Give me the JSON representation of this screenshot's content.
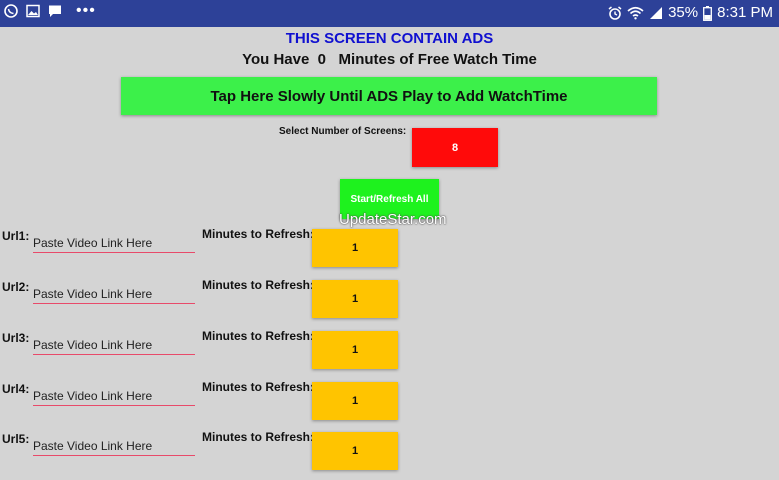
{
  "status_bar": {
    "battery": "35%",
    "time": "8:31 PM",
    "left_icons": [
      "viber-icon",
      "gallery-icon",
      "message-icon",
      "more-icon"
    ],
    "right_icons": [
      "alarm-icon",
      "wifi-icon",
      "signal-icon",
      "battery-icon"
    ]
  },
  "header": {
    "ads_notice": "THIS SCREEN CONTAIN ADS",
    "watch_prefix": "You Have",
    "watch_minutes": "0",
    "watch_suffix": "Minutes of Free Watch Time"
  },
  "ads_button_label": "Tap Here Slowly Until ADS Play to Add WatchTime",
  "screens": {
    "label": "Select Number of Screens:",
    "value": "8"
  },
  "start_button_label": "Start/Refresh All",
  "watermark": "UpdateStar.com",
  "rows": [
    {
      "url_label": "Url1:",
      "placeholder": "Paste Video Link Here",
      "minutes_label": "Minutes to Refresh:",
      "minutes": "1"
    },
    {
      "url_label": "Url2:",
      "placeholder": "Paste Video Link Here",
      "minutes_label": "Minutes to Refresh:",
      "minutes": "1"
    },
    {
      "url_label": "Url3:",
      "placeholder": "Paste Video Link Here",
      "minutes_label": "Minutes to Refresh:",
      "minutes": "1"
    },
    {
      "url_label": "Url4:",
      "placeholder": "Paste Video Link Here",
      "minutes_label": "Minutes to Refresh:",
      "minutes": "1"
    },
    {
      "url_label": "Url5:",
      "placeholder": "Paste Video Link Here",
      "minutes_label": "Minutes to Refresh:",
      "minutes": "1"
    }
  ],
  "colors": {
    "status_bar": "#2d4198",
    "ads_notice": "#1010d0",
    "ads_button": "#3cf04a",
    "screens_button": "#ff0a0a",
    "start_button": "#1ef21e",
    "minutes_button": "#ffc400",
    "url_underline": "#e84a6a"
  }
}
